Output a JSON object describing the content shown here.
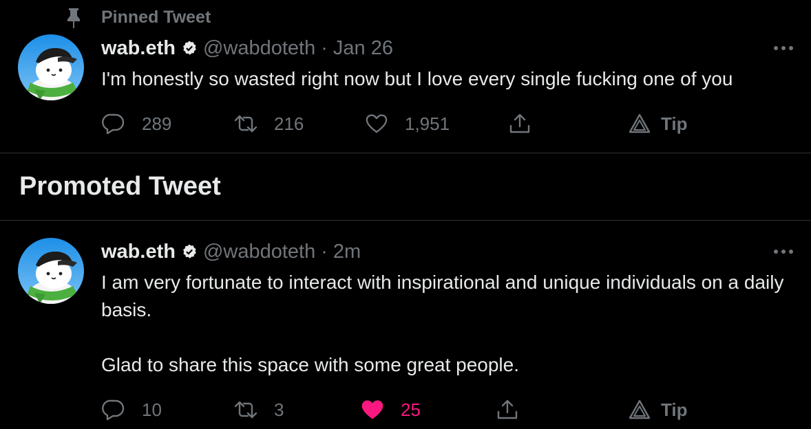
{
  "pinned": {
    "label": "Pinned Tweet"
  },
  "tweet1": {
    "display_name": "wab.eth",
    "handle": "@wabdoteth",
    "separator": "·",
    "time": "Jan 26",
    "text": "I'm honestly so wasted right now but I love every single fucking one of you",
    "replies": "289",
    "retweets": "216",
    "likes": "1,951",
    "tip": "Tip",
    "liked": false
  },
  "section": {
    "heading": "Promoted Tweet"
  },
  "tweet2": {
    "display_name": "wab.eth",
    "handle": "@wabdoteth",
    "separator": "·",
    "time": "2m",
    "text": "I am very fortunate to interact with inspirational and unique individuals on a daily basis.\n\nGlad to share this space with some great people.",
    "replies": "10",
    "retweets": "3",
    "likes": "25",
    "tip": "Tip",
    "liked": true
  },
  "colors": {
    "background": "#000000",
    "text_primary": "#e7e9ea",
    "text_secondary": "#71767b",
    "divider": "#2f3336",
    "like_active": "#f91880"
  },
  "icons": {
    "pin": "pin-icon",
    "verified": "verified-badge-icon",
    "more": "more-horizontal-icon",
    "reply": "reply-icon",
    "retweet": "retweet-icon",
    "like": "heart-icon",
    "share": "share-icon",
    "tip": "tip-icon"
  }
}
